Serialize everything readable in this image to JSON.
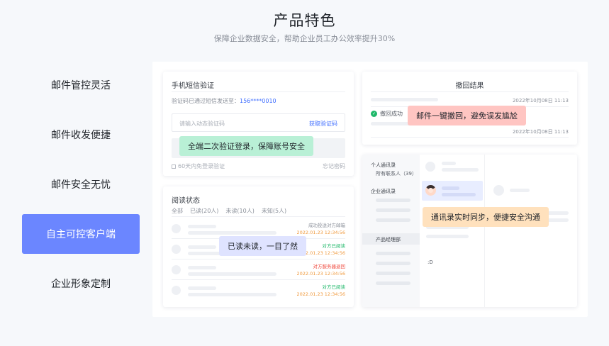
{
  "header": {
    "title": "产品特色",
    "subtitle": "保障企业数据安全，帮助企业员工办公效率提升30%"
  },
  "nav": {
    "items": [
      {
        "label": "邮件管控灵活"
      },
      {
        "label": "邮件收发便捷"
      },
      {
        "label": "邮件安全无忧"
      },
      {
        "label": "自主可控客户端"
      },
      {
        "label": "企业形象定制"
      }
    ],
    "active_index": 3
  },
  "sms_card": {
    "title": "手机短信验证",
    "sent_text": "验证码已通过短信发送至：",
    "phone": "156****0010",
    "code_placeholder": "请输入动态验证码",
    "get_code": "获取验证码",
    "remember": "60天内免登录验证",
    "forgot": "忘记密码",
    "tooltip": "全端二次验证登录，保障账号安全"
  },
  "recall_card": {
    "title": "撤回结果",
    "date1": "2022年10月08日 11:13",
    "status": "撤回成功",
    "date2": "2022年10月08日 11:13",
    "tooltip": "邮件一键撤回，避免误发尴尬"
  },
  "read_card": {
    "title": "阅读状态",
    "tabs": [
      "全部",
      "已读(20人)",
      "未读(10人)",
      "未知(5人)"
    ],
    "rows": [
      {
        "status": "成功投送对方邮箱",
        "time": "2022.01.23 12:34:56",
        "color": "#8a8f99"
      },
      {
        "status": "对方已阅读",
        "time": "2022.01.23 12:34:56",
        "color": "#1fb86a"
      },
      {
        "status": "对方服务器退回",
        "time": "2022.01.23 12:34:56",
        "color": "#f04a3e"
      },
      {
        "status": "对方已阅读",
        "time": "2022.01.23 12:34:56",
        "color": "#1fb86a"
      }
    ],
    "tooltip": "已读未读，一目了然"
  },
  "contacts_card": {
    "personal": "个人通讯录",
    "all_contacts": "所有联系人（39）",
    "corporate": "企业通讯录",
    "dept": "产品经理部",
    "tooltip": "通讯录实时同步，便捷安全沟通"
  },
  "colors": {
    "accent": "#6b86ff",
    "link": "#3e6dff",
    "success": "#1fb86a",
    "error": "#f04a3e",
    "tip_green": "#b9f0d6",
    "tip_red": "#ffc5c2",
    "tip_purple": "#dfe3ff",
    "tip_orange": "#ffe1bd"
  }
}
